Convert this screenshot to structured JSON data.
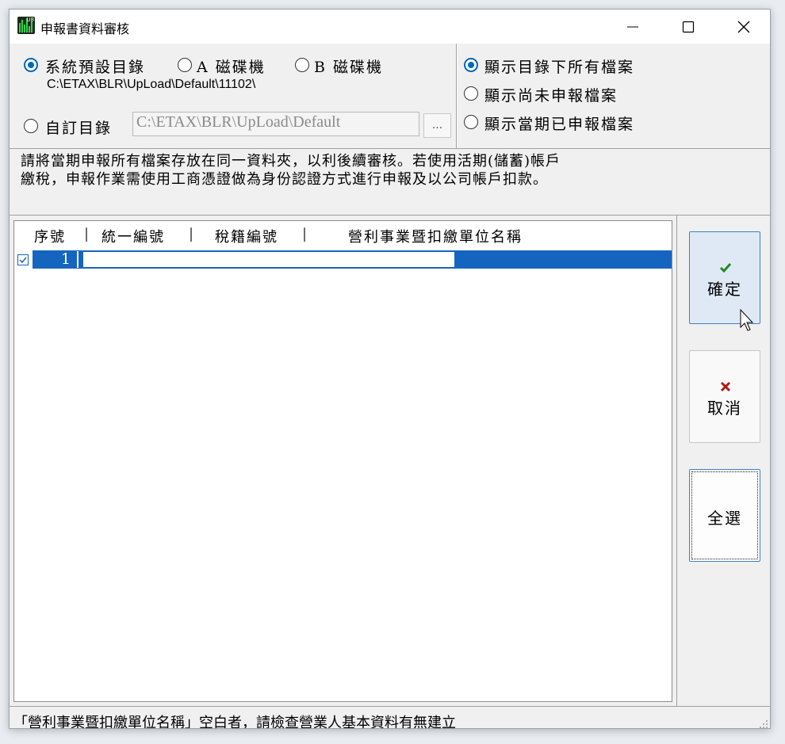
{
  "window": {
    "title": "申報書資料審核"
  },
  "source": {
    "options": [
      "系統預設目錄",
      "A 磁碟機",
      "B 磁碟機"
    ],
    "selected": "系統預設目錄",
    "default_path": "C:\\ETAX\\BLR\\UpLoad\\Default\\11102\\",
    "custom_label": "自訂目錄",
    "custom_path": "C:\\ETAX\\BLR\\UpLoad\\Default",
    "browse_label": "..."
  },
  "filter": {
    "options": [
      "顯示目錄下所有檔案",
      "顯示尚未申報檔案",
      "顯示當期已申報檔案"
    ],
    "selected": "顯示目錄下所有檔案"
  },
  "info": "請將當期申報所有檔案存放在同一資料夾，以利後續審核。若使用活期(儲蓄)帳戶\n繳稅，申報作業需使用工商憑證做為身份認證方式進行申報及以公司帳戶扣款。",
  "list": {
    "headers": [
      "序號",
      "統一編號",
      "稅籍編號",
      "營利事業暨扣繳單位名稱"
    ],
    "rows": [
      {
        "checked": true,
        "seq": "1",
        "tax_id": "",
        "reg_no": "",
        "name": ""
      }
    ]
  },
  "buttons": {
    "ok": "確定",
    "cancel": "取消",
    "select_all": "全選"
  },
  "status": "「營利事業暨扣繳單位名稱」空白者，請檢查營業人基本資料有無建立",
  "colors": {
    "accent": "#0067c0",
    "selection": "#1565c0"
  }
}
